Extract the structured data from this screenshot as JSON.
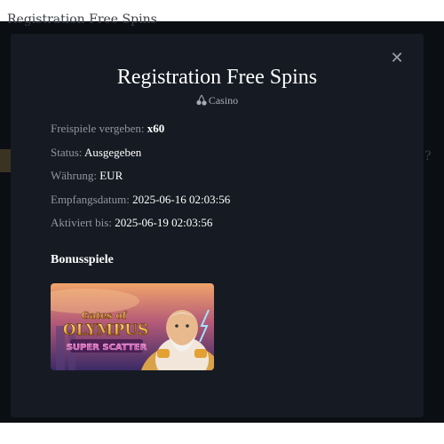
{
  "background": {
    "title": "Registration Free Spins"
  },
  "modal": {
    "title": "Registration Free Spins",
    "category": "Casino",
    "close_icon": "close-icon",
    "details": [
      {
        "label": "Freispiele vergeben:",
        "value": "x60",
        "bold": true
      },
      {
        "label": "Status:",
        "value": "Ausgegeben",
        "bold": false
      },
      {
        "label": "Währung:",
        "value": "EUR",
        "bold": false
      },
      {
        "label": "Empfangsdatum:",
        "value": "2025-06-16 02:03:56",
        "bold": false
      },
      {
        "label": "Aktiviert bis:",
        "value": "2025-06-19 02:03:56",
        "bold": false
      }
    ],
    "bonus_section_title": "Bonusspiele",
    "games": [
      {
        "logo_line1": "Gates of",
        "logo_line2": "OLYMPUS",
        "logo_line3": "SUPER SCATTER"
      }
    ]
  },
  "colors": {
    "modal_bg": "#161b23",
    "backdrop": "#0b0e13",
    "label": "#8f96a2",
    "value": "#ffffff"
  }
}
